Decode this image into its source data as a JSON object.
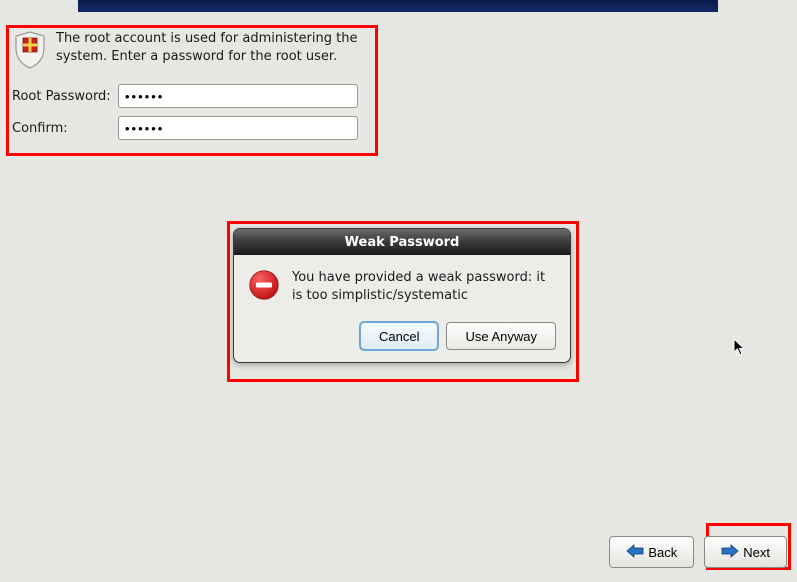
{
  "root": {
    "description": "The root account is used for administering the system.  Enter a password for the root user.",
    "password_label": "Root Password:",
    "confirm_label": "Confirm:",
    "password_value": "••••••",
    "confirm_value": "••••••"
  },
  "dialog": {
    "title": "Weak Password",
    "message": "You have provided a weak password: it is too simplistic/systematic",
    "cancel": "Cancel",
    "use_anyway": "Use Anyway"
  },
  "nav": {
    "back": "Back",
    "next": "Next"
  }
}
